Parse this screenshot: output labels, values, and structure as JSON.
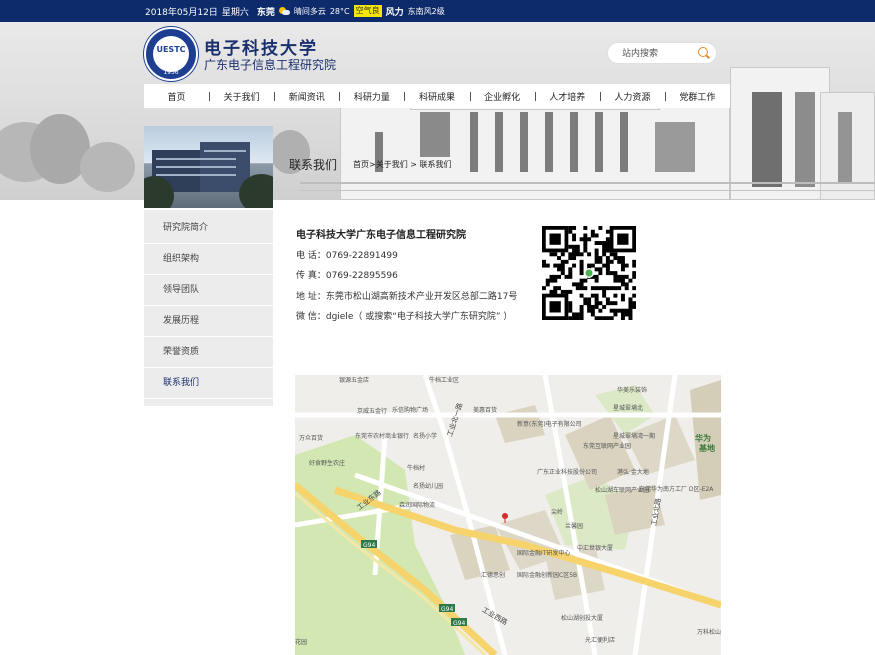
{
  "topbar": {
    "date": "2018年05月12日",
    "weekday": "星期六",
    "city": "东莞",
    "weather": "晴间多云",
    "temp": "28°C",
    "aqi_label": "空气良",
    "wind_label": "风力",
    "wind": "东南风2级"
  },
  "logo": {
    "abbr": "UESTC",
    "year": "1956"
  },
  "brand": {
    "title": "电子科技大学",
    "subtitle": "广东电子信息工程研究院"
  },
  "search": {
    "placeholder": "站内搜索"
  },
  "nav": [
    "首页",
    "关于我们",
    "新闻资讯",
    "科研力量",
    "科研成果",
    "企业孵化",
    "人才培养",
    "人力资源",
    "党群工作"
  ],
  "page": {
    "title": "联系我们",
    "breadcrumb": "首页>关于我们 > 联系我们"
  },
  "sidebar": [
    {
      "label": "研究院简介"
    },
    {
      "label": "组织架构"
    },
    {
      "label": "领导团队"
    },
    {
      "label": "发展历程"
    },
    {
      "label": "荣誉资质"
    },
    {
      "label": "联系我们",
      "active": true
    }
  ],
  "contact": {
    "org": "电子科技大学广东电子信息工程研究院",
    "phone": "电 话：0769-22891499",
    "fax": "传 真：0769-22895596",
    "address": "地 址：东莞市松山湖高新技术产业开发区总部二路17号",
    "wechat": "微 信：dgiele（ 或搜索“电子科技大学广东研究院” ）"
  },
  "map": {
    "labels": [
      "银源五金店",
      "牛档工业区",
      "华美乐装饰",
      "乐信购物广场",
      "美惠百货",
      "星城翠埔北",
      "京威五金行",
      "新意(东莞)电子有限公司",
      "万众百货",
      "东莞市农村商业银行",
      "名扬小学",
      "东莞互联网产业园",
      "星城翠埔湾一期",
      "华为",
      "基地",
      "牛档村",
      "好食野生农庄",
      "广东正业科技股份公司",
      "港弘·金大地",
      "东莞华为南方工厂 D区-E2A",
      "名扬幼儿园",
      "松山湖车联网产业园",
      "森润国际物流",
      "尖岭",
      "兰馨园",
      "中汇世银大厦",
      "国际金融IT研发中心",
      "汇德思创",
      "国际金融创新园C区5B",
      "万科松山湖研究院",
      "松山湖创投大厦",
      "光汇便利店",
      "花园"
    ],
    "roads": [
      "工业东路",
      "工业北一路",
      "工业西路",
      "工业北路"
    ],
    "highway": "G94",
    "road_color": "#f7d36b",
    "green_color": "#d2e7b2",
    "building_color": "#d9d3c0"
  }
}
